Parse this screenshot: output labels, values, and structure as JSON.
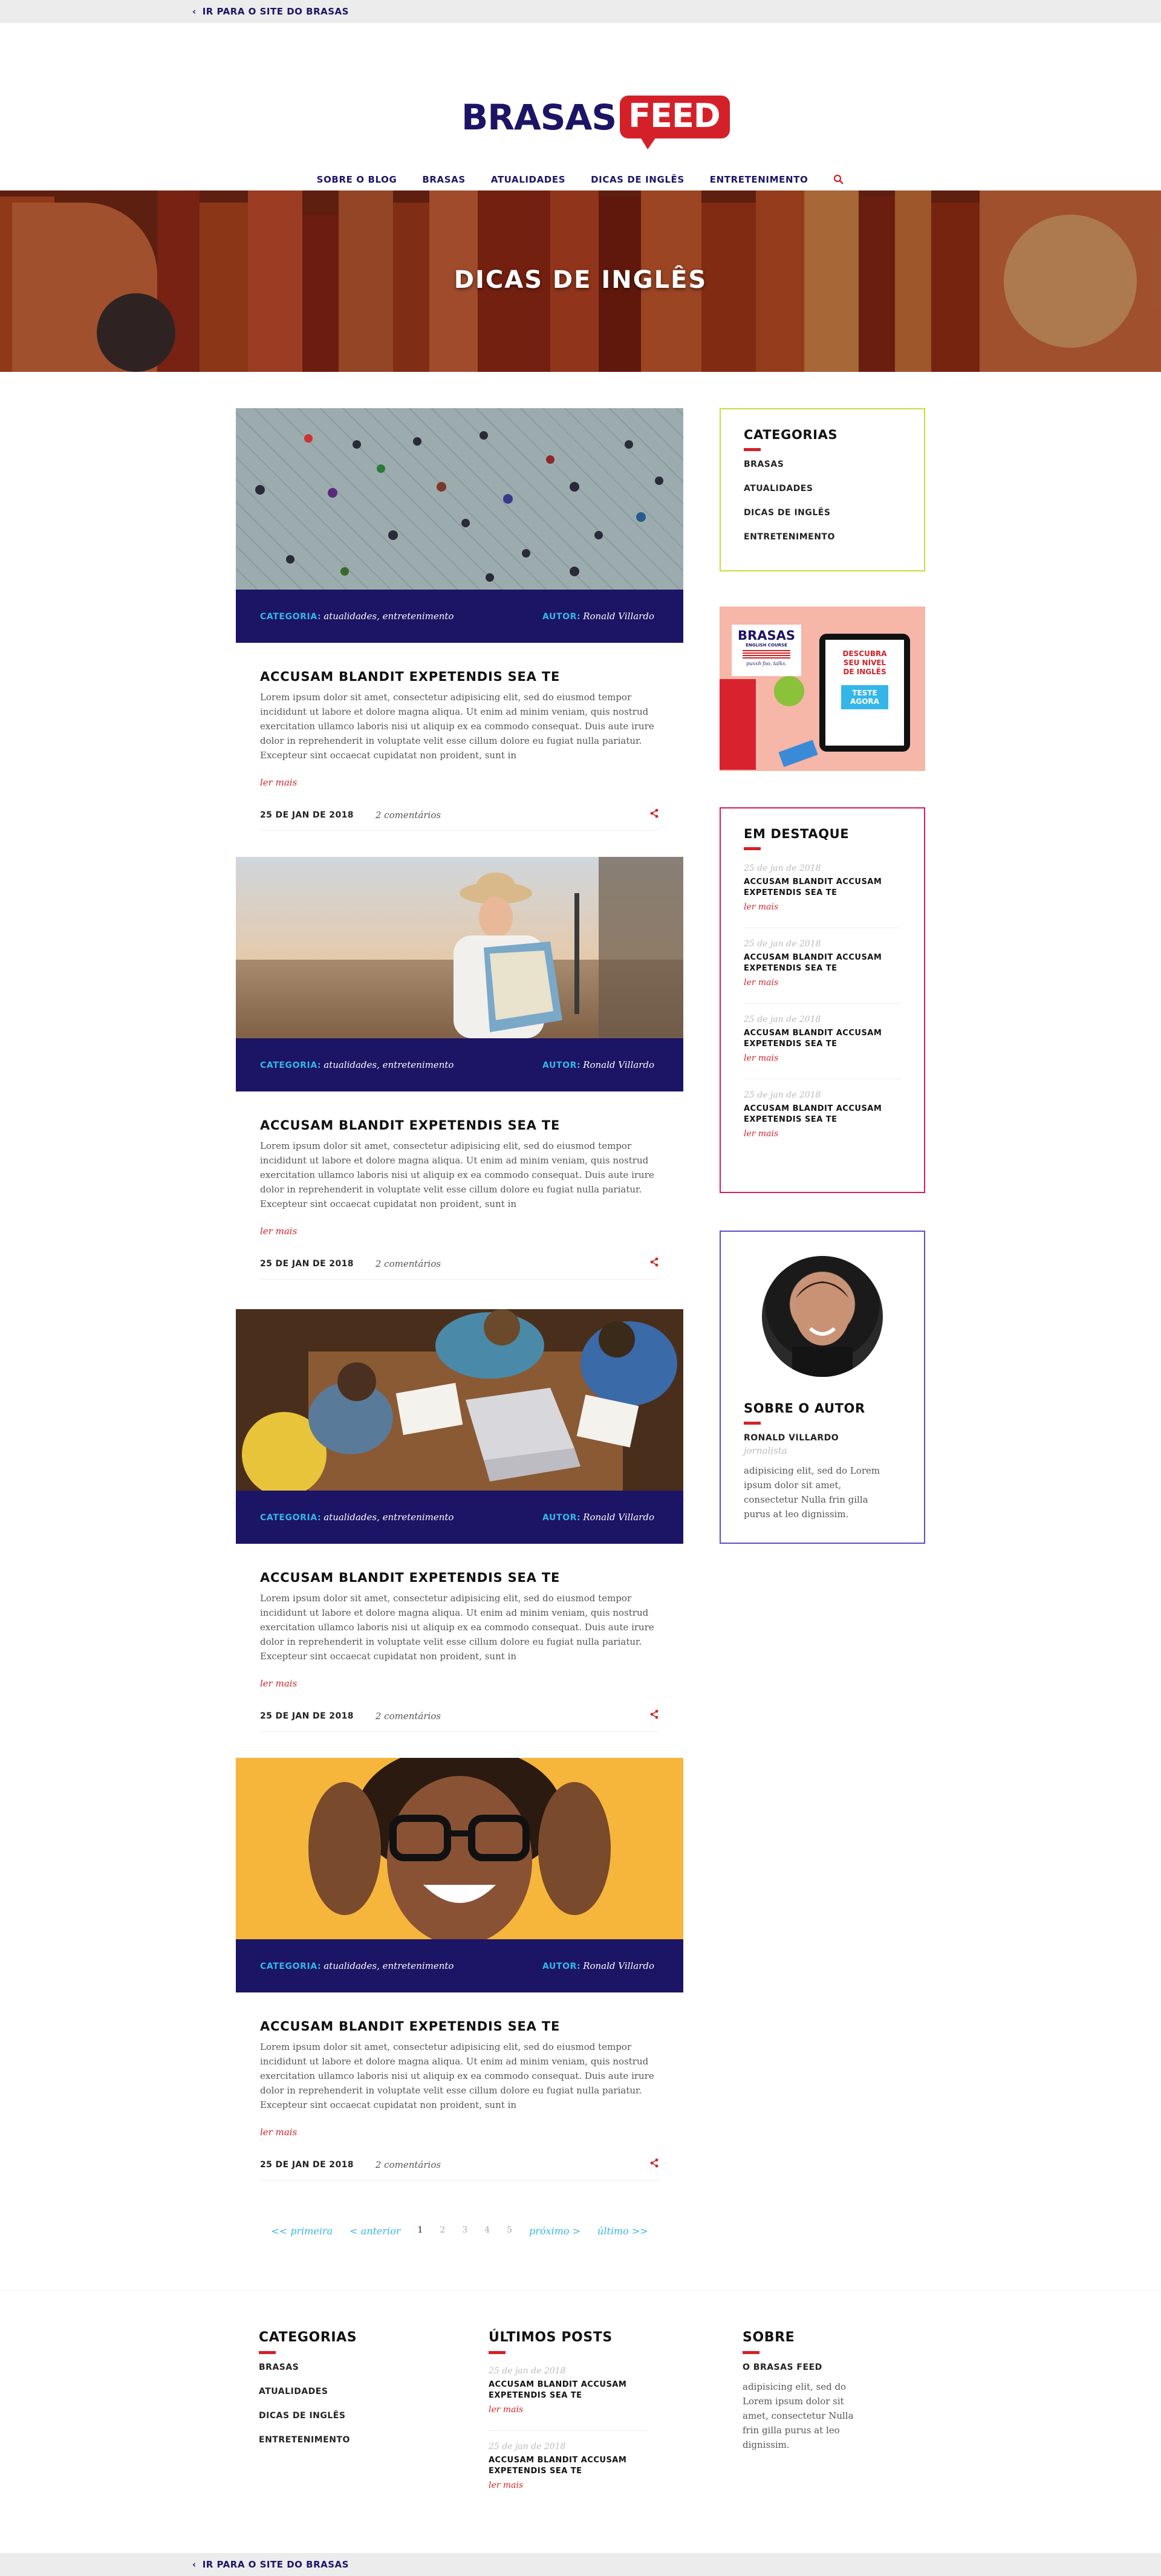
{
  "top_link": "IR PARA O SITE DO BRASAS",
  "logo": {
    "part1": "BRASAS",
    "part2": "FEED"
  },
  "nav": [
    "SOBRE O BLOG",
    "BRASAS",
    "ATUALIDADES",
    "DICAS DE INGLÊS",
    "ENTRETENIMENTO"
  ],
  "hero": {
    "title": "DICAS DE INGLÊS"
  },
  "posts": [
    {
      "category_label": "CATEGORIA:",
      "categories": "atualidades, entretenimento",
      "author_label": "AUTOR:",
      "author": "Ronald Villardo",
      "title": "ACCUSAM BLANDIT EXPETENDIS SEA TE",
      "excerpt": "Lorem ipsum dolor sit amet, consectetur adipisicing elit, sed do eiusmod tempor incididunt ut labore et dolore magna aliqua. Ut enim ad minim veniam, quis nostrud exercitation ullamco laboris nisi ut aliquip ex ea commodo consequat. Duis aute irure dolor in reprehenderit in voluptate velit esse cillum dolore eu fugiat nulla pariatur. Excepteur sint occaecat cupidatat non proident, sunt in",
      "read_more": "ler mais",
      "date": "25 DE JAN DE 2018",
      "comments": "2 comentários"
    },
    {
      "category_label": "CATEGORIA:",
      "categories": "atualidades, entretenimento",
      "author_label": "AUTOR:",
      "author": "Ronald Villardo",
      "title": "ACCUSAM BLANDIT EXPETENDIS SEA TE",
      "excerpt": "Lorem ipsum dolor sit amet, consectetur adipisicing elit, sed do eiusmod tempor incididunt ut labore et dolore magna aliqua. Ut enim ad minim veniam, quis nostrud exercitation ullamco laboris nisi ut aliquip ex ea commodo consequat. Duis aute irure dolor in reprehenderit in voluptate velit esse cillum dolore eu fugiat nulla pariatur. Excepteur sint occaecat cupidatat non proident, sunt in",
      "read_more": "ler mais",
      "date": "25 DE JAN DE 2018",
      "comments": "2 comentários"
    },
    {
      "category_label": "CATEGORIA:",
      "categories": "atualidades, entretenimento",
      "author_label": "AUTOR:",
      "author": "Ronald Villardo",
      "title": "ACCUSAM BLANDIT EXPETENDIS SEA TE",
      "excerpt": "Lorem ipsum dolor sit amet, consectetur adipisicing elit, sed do eiusmod tempor incididunt ut labore et dolore magna aliqua. Ut enim ad minim veniam, quis nostrud exercitation ullamco laboris nisi ut aliquip ex ea commodo consequat. Duis aute irure dolor in reprehenderit in voluptate velit esse cillum dolore eu fugiat nulla pariatur. Excepteur sint occaecat cupidatat non proident, sunt in",
      "read_more": "ler mais",
      "date": "25 DE JAN DE 2018",
      "comments": "2 comentários"
    },
    {
      "category_label": "CATEGORIA:",
      "categories": "atualidades, entretenimento",
      "author_label": "AUTOR:",
      "author": "Ronald Villardo",
      "title": "ACCUSAM BLANDIT EXPETENDIS SEA TE",
      "excerpt": "Lorem ipsum dolor sit amet, consectetur adipisicing elit, sed do eiusmod tempor incididunt ut labore et dolore magna aliqua. Ut enim ad minim veniam, quis nostrud exercitation ullamco laboris nisi ut aliquip ex ea commodo consequat. Duis aute irure dolor in reprehenderit in voluptate velit esse cillum dolore eu fugiat nulla pariatur. Excepteur sint occaecat cupidatat non proident, sunt in",
      "read_more": "ler mais",
      "date": "25 DE JAN DE 2018",
      "comments": "2 comentários"
    }
  ],
  "pagination": {
    "first": "<< primeira",
    "prev": "< anterior",
    "pages": [
      "1",
      "2",
      "3",
      "4",
      "5"
    ],
    "next": "próximo >",
    "last": "último >>"
  },
  "sidebar": {
    "categories": {
      "title": "CATEGORIAS",
      "items": [
        "BRASAS",
        "ATUALIDADES",
        "DICAS DE INGLÊS",
        "ENTRETENIMENTO"
      ]
    },
    "ad": {
      "brand": "BRASAS",
      "brand_sub": "ENGLISH COURSE",
      "tagline": "puxxh foo, talks.",
      "line1": "DESCUBRA",
      "line2": "SEU NÍVEL",
      "line3": "DE INGLÊS",
      "button1": "TESTE",
      "button2": "AGORA"
    },
    "featured": {
      "title": "EM DESTAQUE",
      "items": [
        {
          "date": "25 de jan de 2018",
          "title": "ACCUSAM BLANDIT ACCUSAM EXPETENDIS SEA TE",
          "link": "ler mais"
        },
        {
          "date": "25 de jan de 2018",
          "title": "ACCUSAM BLANDIT ACCUSAM EXPETENDIS SEA TE",
          "link": "ler mais"
        },
        {
          "date": "25 de jan de 2018",
          "title": "ACCUSAM BLANDIT ACCUSAM EXPETENDIS SEA TE",
          "link": "ler mais"
        },
        {
          "date": "25 de jan de 2018",
          "title": "ACCUSAM BLANDIT ACCUSAM EXPETENDIS SEA TE",
          "link": "ler mais"
        }
      ]
    },
    "author": {
      "title": "SOBRE O AUTOR",
      "name": "RONALD VILLARDO",
      "role": "jornalista",
      "bio": "adipisicing elit, sed do Lorem ipsum dolor sit amet, consectetur Nulla frin gilla purus at leo dignissim."
    }
  },
  "footer": {
    "categories": {
      "title": "CATEGORIAS",
      "items": [
        "BRASAS",
        "ATUALIDADES",
        "DICAS DE INGLÊS",
        "ENTRETENIMENTO"
      ]
    },
    "latest": {
      "title": "ÚLTIMOS POSTS",
      "items": [
        {
          "date": "25 de jan de 2018",
          "title": "ACCUSAM BLANDIT ACCUSAM EXPETENDIS SEA TE",
          "link": "ler mais"
        },
        {
          "date": "25 de jan de 2018",
          "title": "ACCUSAM BLANDIT ACCUSAM EXPETENDIS SEA TE",
          "link": "ler mais"
        }
      ]
    },
    "about": {
      "title": "SOBRE",
      "name": "O BRASAS FEED",
      "text": "adipisicing elit, sed do Lorem ipsum dolor sit amet, consectetur Nulla frin gilla purus at leo dignissim."
    }
  },
  "bottom_link": "IR PARA O SITE DO BRASAS",
  "colors": {
    "brand_navy": "#1c1464",
    "brand_red": "#d42129",
    "accent_blue": "#35b6e8",
    "box_lime": "#c8dc3c",
    "box_pink": "#d81b60",
    "box_purple": "#5a4fc8"
  }
}
